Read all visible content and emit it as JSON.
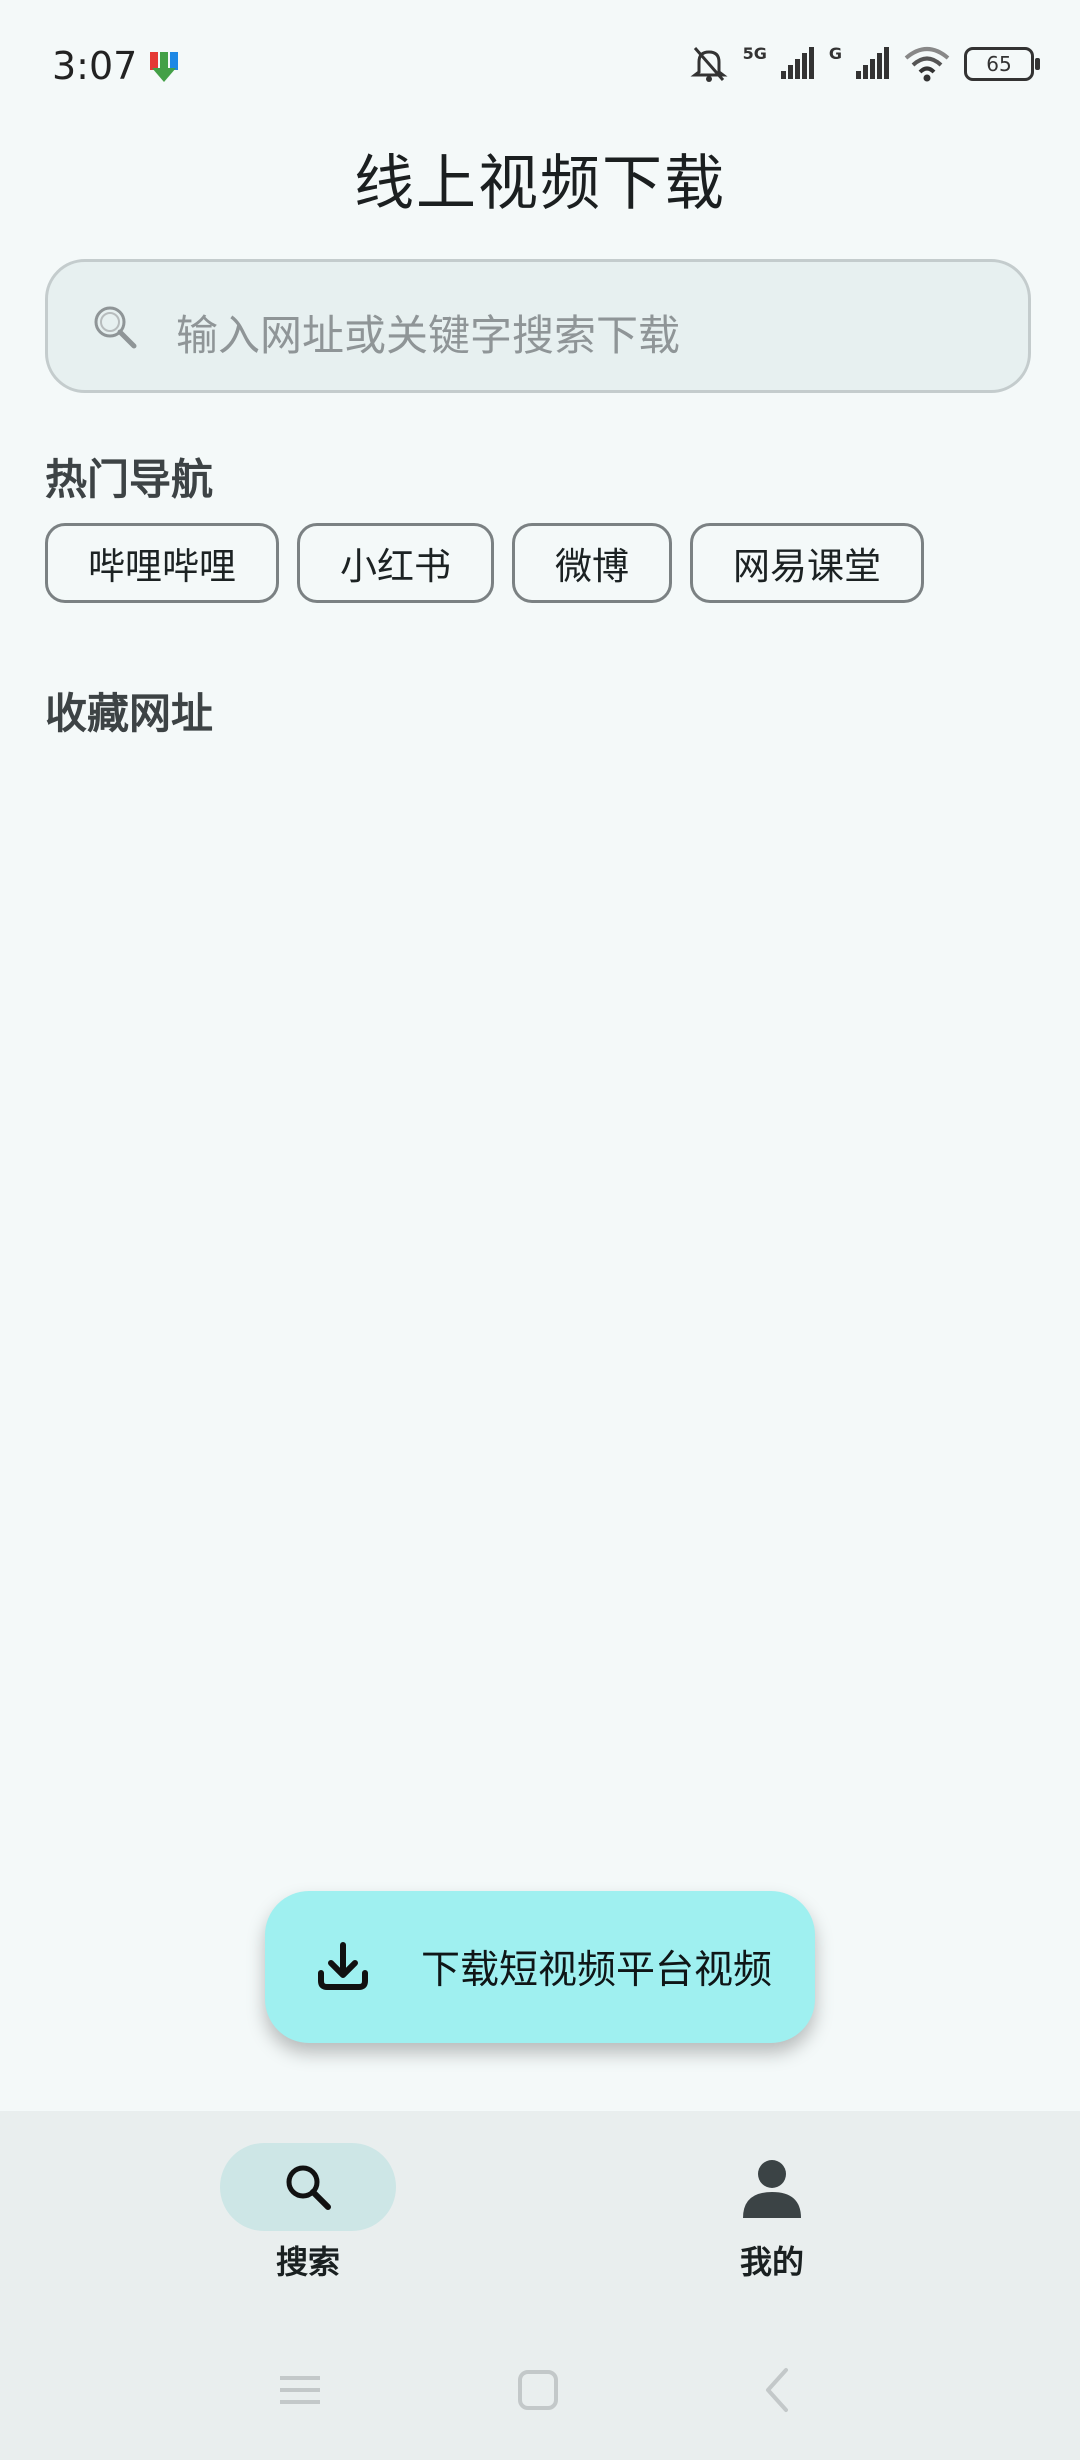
{
  "status_bar": {
    "time": "3:07",
    "network_1": "5G",
    "network_2": "G",
    "battery": "65"
  },
  "page": {
    "title": "线上视频下载"
  },
  "search": {
    "placeholder": "输入网址或关键字搜索下载"
  },
  "hot_nav": {
    "title": "热门导航",
    "items": [
      "哔哩哔哩",
      "小红书",
      "微博",
      "网易课堂"
    ]
  },
  "favorites": {
    "title": "收藏网址"
  },
  "fab": {
    "label": "下载短视频平台视频",
    "icon": "download-icon",
    "color": "#9ff0f0"
  },
  "bottom_nav": {
    "items": [
      {
        "label": "搜索",
        "icon": "search-icon",
        "active": true
      },
      {
        "label": "我的",
        "icon": "person-icon",
        "active": false
      }
    ]
  },
  "system_nav": {
    "icons": [
      "menu-icon",
      "home-icon",
      "back-icon"
    ]
  }
}
